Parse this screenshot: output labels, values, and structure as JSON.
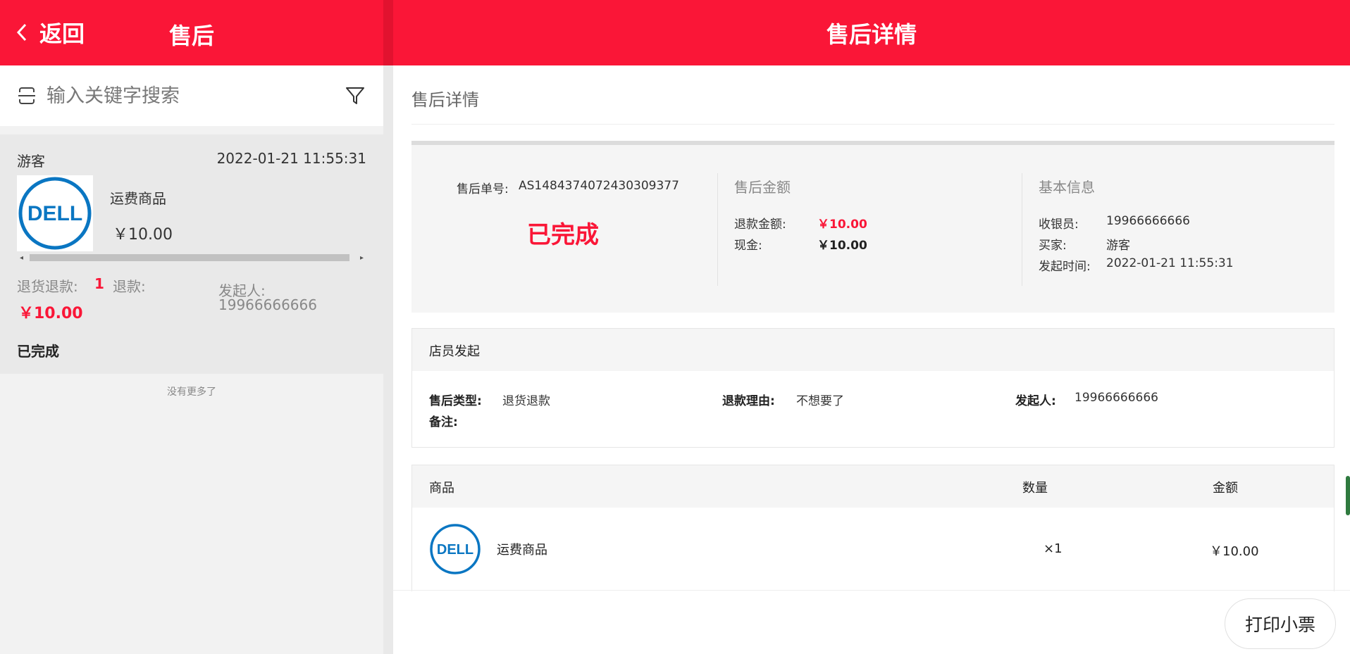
{
  "left_panel": {
    "back_label": "返回",
    "title": "售后",
    "search_placeholder": "输入关键字搜索",
    "order": {
      "customer": "游客",
      "time": "2022-01-21 11:55:31",
      "product_name": "运费商品",
      "price": "￥10.00",
      "type_label": "退货退款:",
      "quantity": "1",
      "refund_label": "退款:",
      "refund_amount": "￥10.00",
      "initiator_label": "发起人:",
      "initiator_value": "19966666666",
      "status": "已完成",
      "logo_text": "DELL"
    },
    "no_more": "没有更多了"
  },
  "right_panel": {
    "title": "售后详情",
    "section_title": "售后详情",
    "summary": {
      "order_label": "售后单号:",
      "order_no": "AS1484374072430309377",
      "status": "已完成",
      "amount_title": "售后金额",
      "refund_label": "退款金额:",
      "refund_value": "￥10.00",
      "cash_label": "现金:",
      "cash_value": "￥10.00",
      "info_title": "基本信息",
      "cashier_label": "收银员:",
      "cashier_value": "19966666666",
      "buyer_label": "买家:",
      "buyer_value": "游客",
      "time_label": "发起时间:",
      "time_value": "2022-01-21 11:55:31"
    },
    "staff": {
      "title": "店员发起",
      "type_label": "售后类型:",
      "type_value": "退货退款",
      "reason_label": "退款理由:",
      "reason_value": "不想要了",
      "initiator_label": "发起人:",
      "initiator_value": "19966666666",
      "note_label": "备注:"
    },
    "goods": {
      "col_name": "商品",
      "col_qty": "数量",
      "col_amount": "金额",
      "rows": [
        {
          "name": "运费商品",
          "qty": "×1",
          "amount": "￥10.00",
          "logo_text": "DELL"
        }
      ]
    },
    "print_label": "打印小票"
  },
  "colors": {
    "brand_red": "#fa1637",
    "dell_blue": "#0a76c2"
  }
}
